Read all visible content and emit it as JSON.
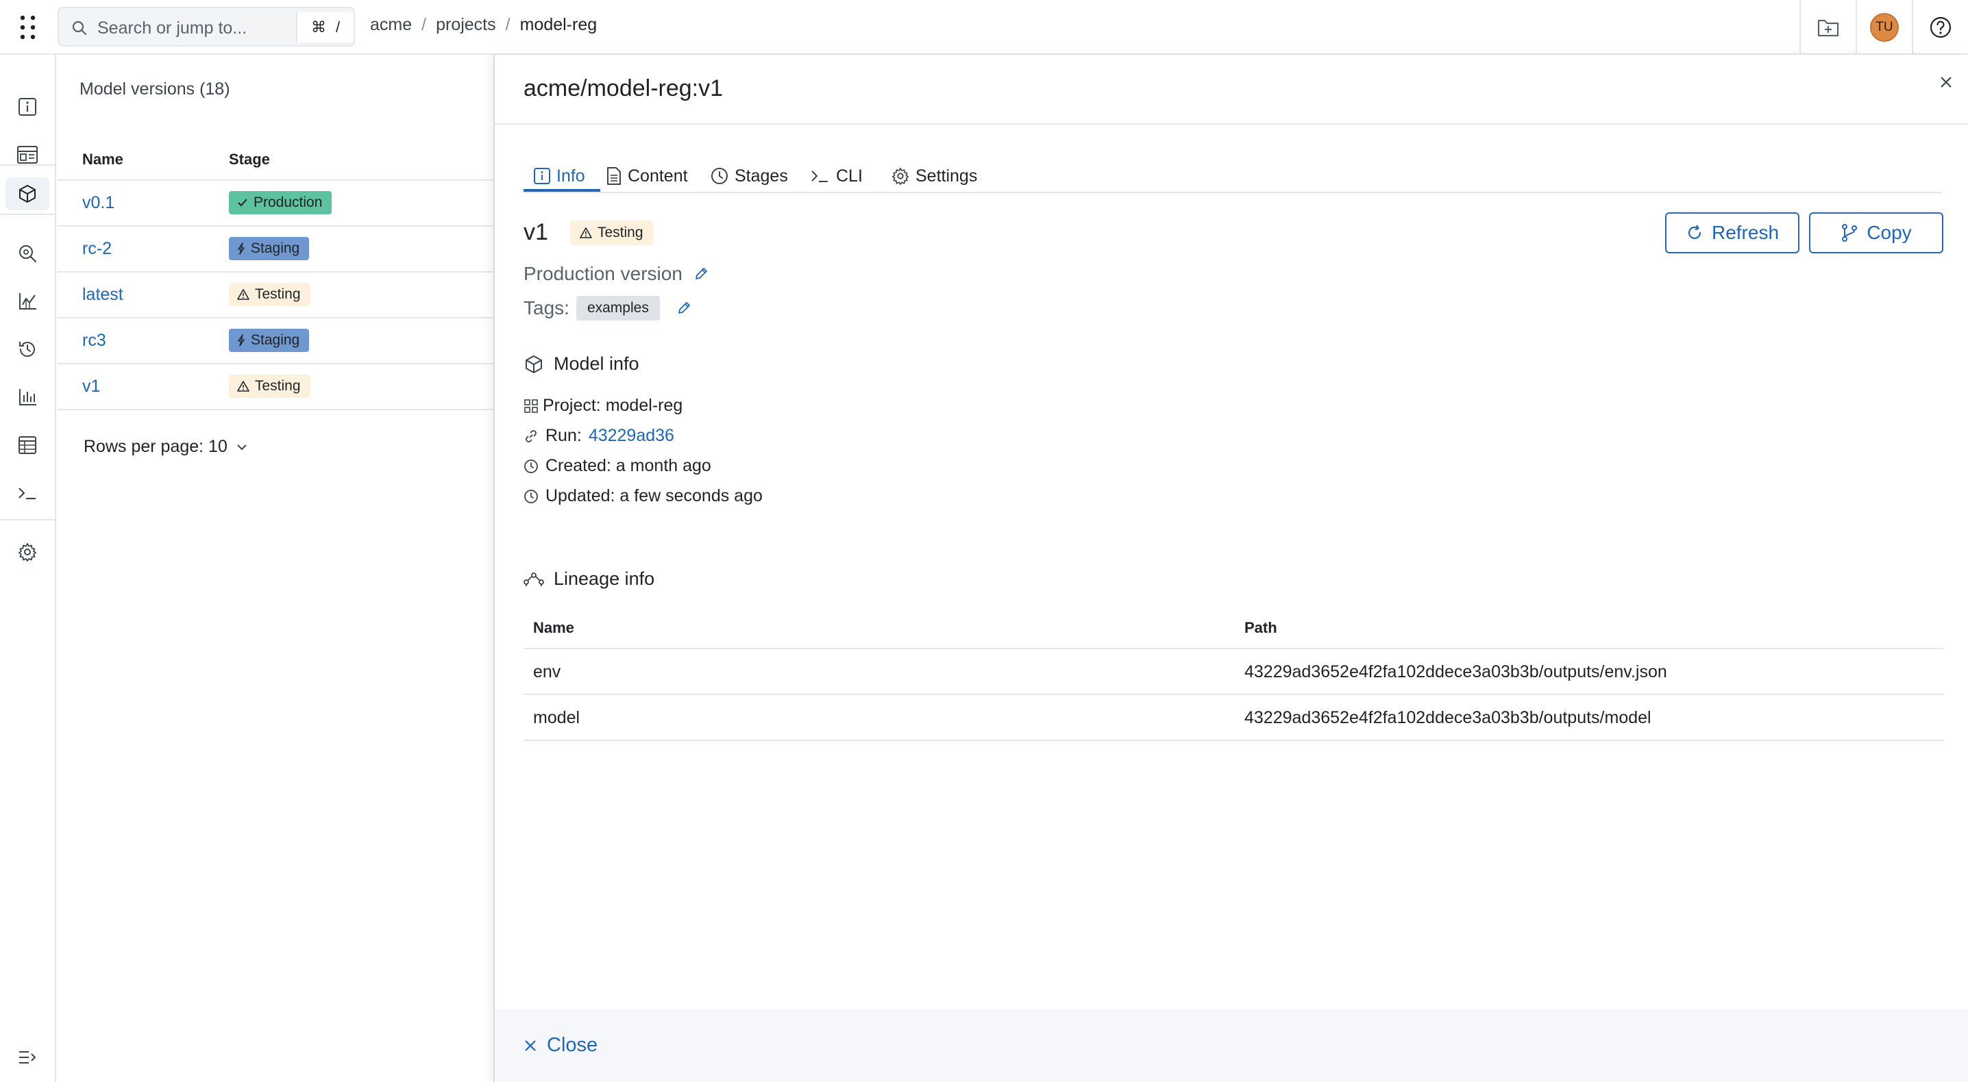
{
  "topbar": {
    "search_placeholder": "Search or jump to...",
    "shortcut_cmd": "⌘",
    "shortcut_key": "/",
    "breadcrumb": [
      "acme",
      "projects",
      "model-reg"
    ],
    "breadcrumb_sep": "/",
    "avatar_initials": "TU"
  },
  "sidenav": {
    "items": [
      "info",
      "dashboard",
      "model-registry",
      "explore",
      "charts",
      "history",
      "reports",
      "tables",
      "console",
      "settings"
    ],
    "active": "model-registry"
  },
  "list": {
    "title": "Model versions (18)",
    "columns": [
      "Name",
      "Stage"
    ],
    "rows": [
      {
        "name": "v0.1",
        "stage": "Production"
      },
      {
        "name": "rc-2",
        "stage": "Staging"
      },
      {
        "name": "latest",
        "stage": "Testing"
      },
      {
        "name": "rc3",
        "stage": "Staging"
      },
      {
        "name": "v1",
        "stage": "Testing"
      }
    ],
    "rows_per_page": "Rows per page: 10"
  },
  "drawer": {
    "title": "acme/model-reg:v1",
    "tabs": [
      "Info",
      "Content",
      "Stages",
      "CLI",
      "Settings"
    ],
    "active_tab": "Info",
    "version": "v1",
    "version_stage": "Testing",
    "refresh_label": "Refresh",
    "copy_label": "Copy",
    "description": "Production version",
    "tags_label": "Tags:",
    "tags": [
      "examples"
    ],
    "model_info": {
      "heading": "Model info",
      "project": "Project: model-reg",
      "run_label": "Run:",
      "run_id": "43229ad36",
      "created": "Created: a month ago",
      "updated": "Updated: a few seconds ago"
    },
    "lineage": {
      "heading": "Lineage info",
      "columns": [
        "Name",
        "Path"
      ],
      "rows": [
        {
          "name": "env",
          "path": "43229ad3652e4f2fa102ddece3a03b3b/outputs/env.json"
        },
        {
          "name": "model",
          "path": "43229ad3652e4f2fa102ddece3a03b3b/outputs/model"
        }
      ]
    },
    "footer_close": "Close"
  },
  "colors": {
    "accent": "#1f67b5",
    "production": "#5ec2a0",
    "staging": "#6e98cf",
    "testing": "#fdf1de",
    "avatar": "#dc8a46"
  }
}
